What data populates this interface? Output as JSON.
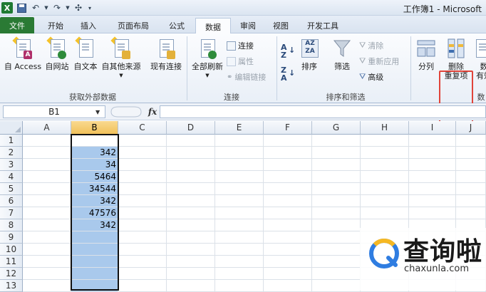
{
  "window": {
    "title": "工作簿1 - Microsoft"
  },
  "qat": {
    "undo": "↶",
    "redo": "↷"
  },
  "tabs": [
    "文件",
    "开始",
    "插入",
    "页面布局",
    "公式",
    "数据",
    "审阅",
    "视图",
    "开发工具"
  ],
  "active_tab": "数据",
  "ribbon": {
    "external": {
      "access": "自 Access",
      "web": "自网站",
      "text": "自文本",
      "other": "自其他来源",
      "existing": "现有连接",
      "group_label": "获取外部数据"
    },
    "connections": {
      "refresh_all": "全部刷新",
      "connections": "连接",
      "properties": "属性",
      "edit_links": "编辑链接",
      "group_label": "连接"
    },
    "sortfilter": {
      "sort": "排序",
      "filter": "筛选",
      "clear": "清除",
      "reapply": "重新应用",
      "advanced": "高级",
      "group_label": "排序和筛选"
    },
    "datatools": {
      "text_to_columns": "分列",
      "remove_dup_line1": "删除",
      "remove_dup_line2": "重复项",
      "validation_line1": "数",
      "validation_line2": "有效",
      "group_label_partial": "数"
    }
  },
  "formula_bar": {
    "name_box": "B1",
    "fx": "fx",
    "value": ""
  },
  "grid": {
    "columns": [
      "A",
      "B",
      "C",
      "D",
      "E",
      "F",
      "G",
      "H",
      "I",
      "J"
    ],
    "rows": [
      "1",
      "2",
      "3",
      "4",
      "5",
      "6",
      "7",
      "8",
      "9",
      "10",
      "11",
      "12",
      "13"
    ],
    "selected_column": "B",
    "column_b_values": [
      "",
      "342",
      "34",
      "5464",
      "34544",
      "342",
      "47576",
      "342",
      "",
      "",
      "",
      "",
      ""
    ]
  },
  "watermark": {
    "text": "查询啦",
    "url": "chaxunla.com"
  },
  "colors": {
    "file_tab": "#2a7a34",
    "selection": "#a9c9ec",
    "highlight": "#e0443a"
  }
}
